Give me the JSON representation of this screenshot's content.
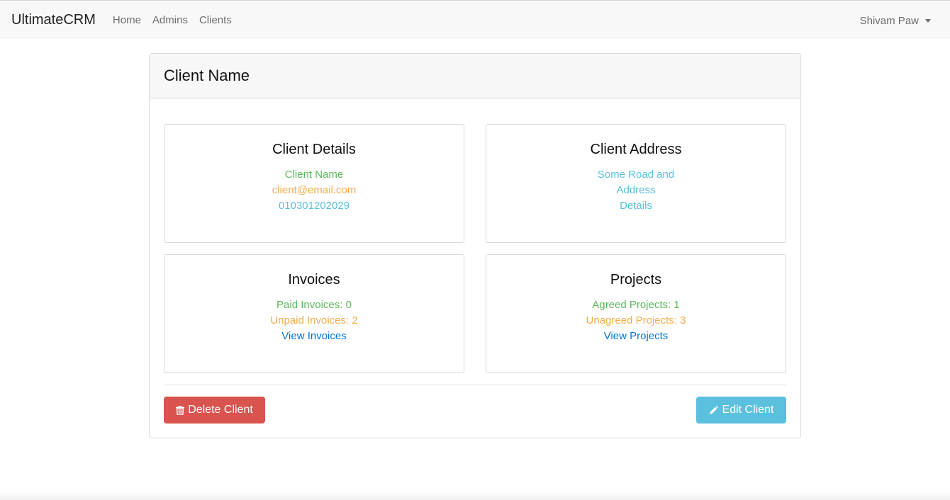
{
  "navbar": {
    "brand": "UltimateCRM",
    "links": [
      "Home",
      "Admins",
      "Clients"
    ],
    "user": "Shivam Paw"
  },
  "card": {
    "title": "Client Name",
    "details": {
      "heading": "Client Details",
      "name": "Client Name",
      "email": "client@email.com",
      "phone": "010301202029"
    },
    "address": {
      "heading": "Client Address",
      "lines": [
        "Some Road and",
        "Address",
        "Details"
      ]
    },
    "invoices": {
      "heading": "Invoices",
      "paid": "Paid Invoices: 0",
      "unpaid": "Unpaid Invoices: 2",
      "link": "View Invoices"
    },
    "projects": {
      "heading": "Projects",
      "agreed": "Agreed Projects: 1",
      "unagreed": "Unagreed Projects: 3",
      "link": "View Projects"
    },
    "buttons": {
      "delete": "Delete Client",
      "edit": "Edit Client"
    }
  },
  "colors": {
    "success": "#5cb85c",
    "warning": "#f0ad4e",
    "info": "#5bc0de",
    "danger": "#d9534f",
    "link": "#0275d8"
  },
  "icons": {
    "delete": "trash-icon",
    "edit": "pencil-icon",
    "user_menu": "caret-down-icon"
  }
}
